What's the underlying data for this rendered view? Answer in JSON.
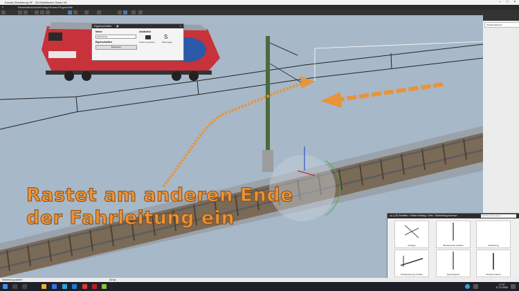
{
  "window": {
    "title": "Tutorial Oberleitung HF - 3D-Modellbahn Studio V6"
  },
  "menu": [
    "Bearbeiten",
    "Ansicht",
    "Vorlage",
    "Extras",
    "Plugins",
    "Hilfe"
  ],
  "overlay": {
    "line1": "Rastet am anderen Ende",
    "line2": "der Fahrleitung ein"
  },
  "properties": {
    "header": "Eigenschaften",
    "name_label": "Name",
    "name_value": "Fahrleitung",
    "events_label": "Eigenschaften",
    "edit_button": "Bearbeiten",
    "extra_label": "Zusätzlich",
    "action_left": "Gebiet anpassen",
    "action_right": "Pfad folgen"
  },
  "right_panel": {
    "item": "Streckenbelemer"
  },
  "catalog": {
    "breadcrumb": [
      "3D-Modelle",
      "Online-Katalog",
      "Sets",
      "Oberleitung Anemon"
    ],
    "search_placeholder": "Suchbegriff eingeben",
    "tiles": [
      "Ausleger",
      "Bruckenmast variabel",
      "Fahrleitung",
      "Nachspannung 3 Pfeiler",
      "Quertragwerk",
      "Streckenmasten"
    ]
  },
  "status": {
    "left": "Fahrleitung addiert",
    "fps": "60 fps"
  },
  "clock": {
    "time": "17:27",
    "date": "17.11.2020"
  },
  "colors": {
    "overlay_text": "#e8943a",
    "arrow": "#e8943a",
    "sky": "#a7b8c8",
    "mast": "#4a6b3c"
  }
}
